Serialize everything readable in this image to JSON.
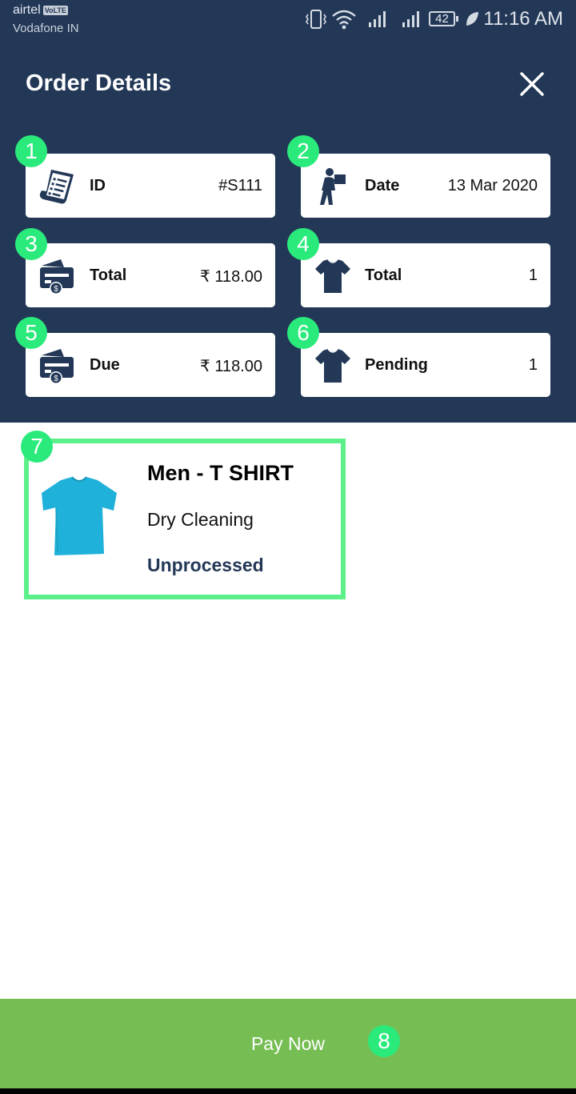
{
  "status_bar": {
    "carrier_primary": "airtel",
    "volte_badge": "VoLTE",
    "carrier_secondary": "Vodafone IN",
    "battery_level": "42",
    "time": "11:16 AM"
  },
  "header": {
    "title": "Order Details",
    "background_color": "#233857"
  },
  "summary_cards": [
    {
      "badge": "1",
      "icon": "receipt-icon",
      "label": "ID",
      "value": "#S111"
    },
    {
      "badge": "2",
      "icon": "delivery-person-icon",
      "label": "Date",
      "value": "13 Mar 2020"
    },
    {
      "badge": "3",
      "icon": "payment-card-icon",
      "label": "Total",
      "value": "₹ 118.00"
    },
    {
      "badge": "4",
      "icon": "tshirt-icon",
      "label": "Total",
      "value": "1"
    },
    {
      "badge": "5",
      "icon": "payment-card-icon",
      "label": "Due",
      "value": "₹ 118.00"
    },
    {
      "badge": "6",
      "icon": "tshirt-icon",
      "label": "Pending",
      "value": "1"
    }
  ],
  "order_item": {
    "badge": "7",
    "name": "Men - T SHIRT",
    "service": "Dry Cleaning",
    "status": "Unprocessed"
  },
  "pay_button": {
    "label": "Pay Now",
    "badge": "8",
    "color": "#76bd53"
  },
  "badge_color": "#2bea7c"
}
